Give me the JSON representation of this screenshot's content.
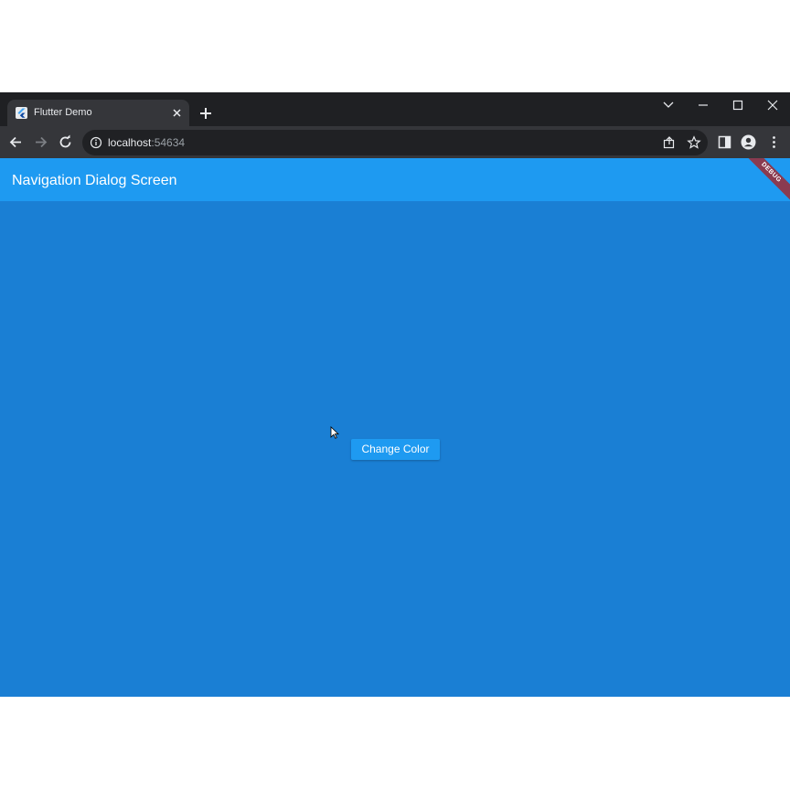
{
  "browser": {
    "tab": {
      "title": "Flutter Demo",
      "favicon": "flutter-icon",
      "close_icon": "close-icon"
    },
    "new_tab_icon": "plus-icon",
    "window_controls": [
      "chevron-down-icon",
      "minimize-icon",
      "maximize-icon",
      "close-icon"
    ],
    "toolbar": {
      "back_icon": "back-arrow-icon",
      "forward_icon": "forward-arrow-icon",
      "reload_icon": "reload-icon",
      "url_host": "localhost",
      "url_port": ":54634",
      "site_info_icon": "info-icon",
      "share_icon": "share-icon",
      "bookmark_icon": "star-icon",
      "side_panel_icon": "side-panel-icon",
      "profile_icon": "profile-icon",
      "menu_icon": "kebab-menu-icon"
    }
  },
  "app": {
    "appbar_title": "Navigation Dialog Screen",
    "debug_banner": "DEBUG",
    "change_color_button": "Change Color",
    "colors": {
      "appbar": "#1e9af1",
      "background": "#1a7fd4",
      "button": "#1e9af1",
      "debug_banner": "#8a3b50"
    }
  }
}
